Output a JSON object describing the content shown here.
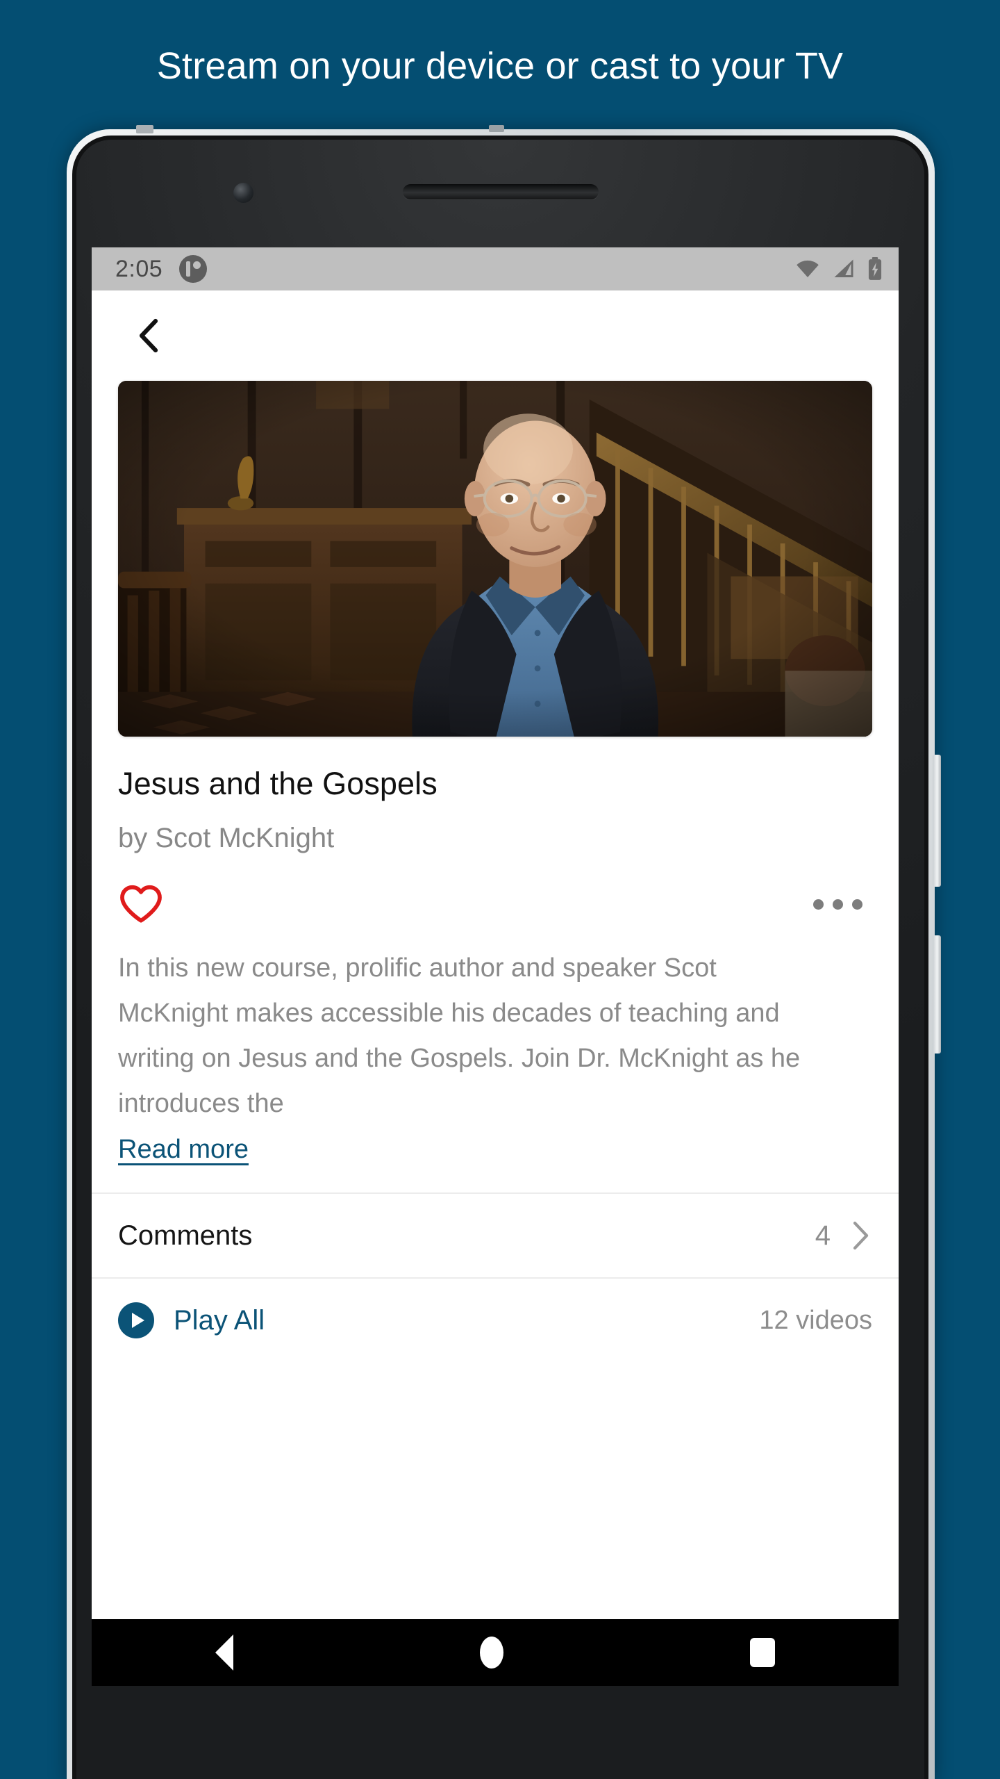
{
  "promo": {
    "headline": "Stream on your device or cast to your TV",
    "background_color": "#044e72"
  },
  "device": {
    "type": "android-phone",
    "frame_color": "#dfe3e5"
  },
  "status_bar": {
    "time": "2:05",
    "app_notification_icon": "app-notification-icon",
    "wifi_icon": "wifi-icon",
    "signal_icon": "cellular-signal-icon",
    "battery_icon": "battery-charging-icon",
    "background_color": "#bfbfbf"
  },
  "app_bar": {
    "back_icon": "chevron-left-icon"
  },
  "course": {
    "hero_image_alt": "Portrait of Scot McKnight seated in a wood panelled room",
    "title": "Jesus and the Gospels",
    "author": "by Scot McKnight",
    "favorite_icon": "heart-outline-icon",
    "favorite_color": "#e01b1b",
    "more_icon": "more-horizontal-icon",
    "description": "In this new course, prolific author and speaker Scot McKnight makes accessible his decades of teaching and writing on Jesus and the Gospels. Join Dr. McKnight as he introduces the",
    "read_more_label": "Read more",
    "link_color": "#0b5377"
  },
  "rows": {
    "comments": {
      "label": "Comments",
      "count": "4",
      "chevron_icon": "chevron-right-icon"
    },
    "play_all": {
      "label": "Play All",
      "play_icon": "play-circle-icon",
      "videos_count": "12 videos"
    }
  },
  "nav_bar": {
    "back_icon": "nav-back-triangle-icon",
    "home_icon": "nav-home-circle-icon",
    "recents_icon": "nav-recents-square-icon"
  }
}
